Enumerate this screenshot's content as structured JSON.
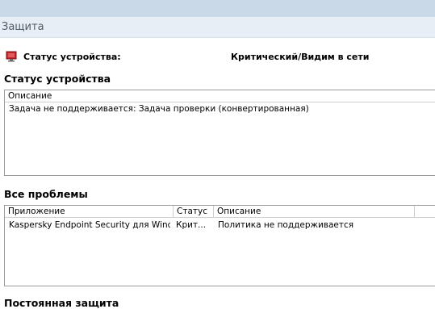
{
  "section": {
    "title": "Защита"
  },
  "device_status": {
    "label": "Статус устройства:",
    "value": "Критический/Видим в сети",
    "icon": "monitor-icon",
    "icon_color": "#c8282d"
  },
  "status_group": {
    "title": "Статус устройства",
    "columns": [
      "Описание"
    ],
    "rows": [
      {
        "description": "Задача не поддерживается: Задача проверки (конвертированная)"
      }
    ]
  },
  "problems_group": {
    "title": "Все проблемы",
    "columns": [
      "Приложение",
      "Статус",
      "Описание"
    ],
    "rows": [
      {
        "application": "Kaspersky Endpoint Security для Wind...",
        "status": "Крит...",
        "description": "Политика не поддерживается"
      }
    ]
  },
  "realtime_group": {
    "title": "Постоянная защита"
  }
}
